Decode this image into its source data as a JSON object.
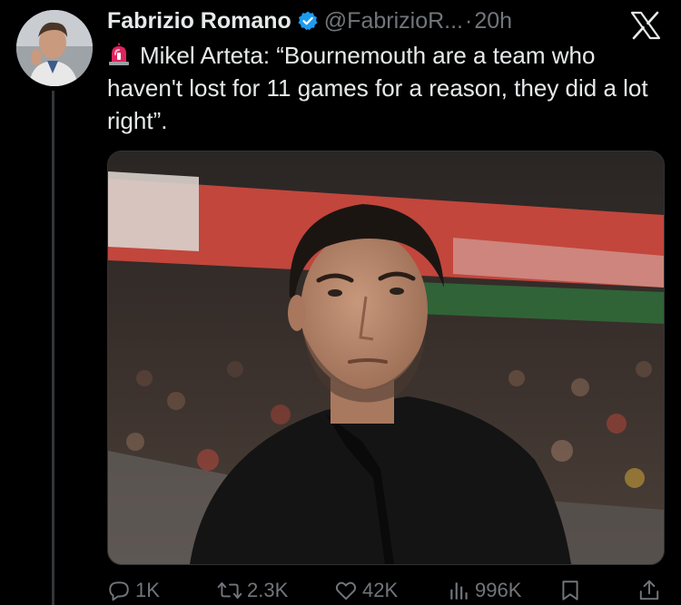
{
  "tweet": {
    "author_name": "Fabrizio Romano",
    "handle": "@FabrizioR...",
    "separator": "·",
    "time": "20h",
    "text": "Mikel Arteta: “Bournemouth are a team who haven't lost for 11 games for a reason, they did a lot right”.",
    "emoji_icon": "police-siren-icon"
  },
  "stats": {
    "replies": "1K",
    "retweets": "2.3K",
    "likes": "42K",
    "views": "996K"
  },
  "colors": {
    "background": "#000000",
    "text": "#e7e9ea",
    "muted": "#71767b",
    "verified": "#1d9bf0",
    "thread_line": "#333639"
  }
}
